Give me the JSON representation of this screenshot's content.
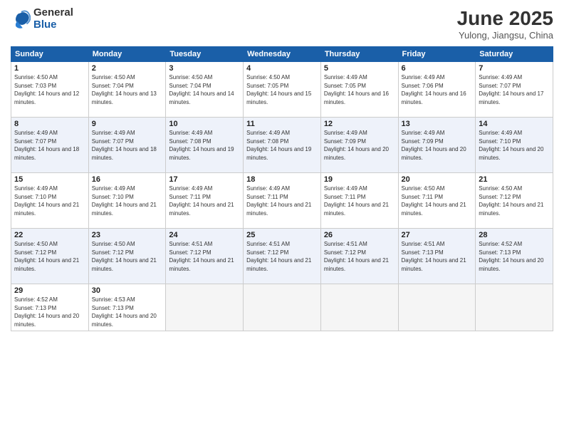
{
  "header": {
    "logo_general": "General",
    "logo_blue": "Blue",
    "title": "June 2025",
    "subtitle": "Yulong, Jiangsu, China"
  },
  "days_of_week": [
    "Sunday",
    "Monday",
    "Tuesday",
    "Wednesday",
    "Thursday",
    "Friday",
    "Saturday"
  ],
  "weeks": [
    [
      {
        "day": "1",
        "sunrise": "4:50 AM",
        "sunset": "7:03 PM",
        "daylight": "14 hours and 12 minutes."
      },
      {
        "day": "2",
        "sunrise": "4:50 AM",
        "sunset": "7:04 PM",
        "daylight": "14 hours and 13 minutes."
      },
      {
        "day": "3",
        "sunrise": "4:50 AM",
        "sunset": "7:04 PM",
        "daylight": "14 hours and 14 minutes."
      },
      {
        "day": "4",
        "sunrise": "4:50 AM",
        "sunset": "7:05 PM",
        "daylight": "14 hours and 15 minutes."
      },
      {
        "day": "5",
        "sunrise": "4:49 AM",
        "sunset": "7:05 PM",
        "daylight": "14 hours and 16 minutes."
      },
      {
        "day": "6",
        "sunrise": "4:49 AM",
        "sunset": "7:06 PM",
        "daylight": "14 hours and 16 minutes."
      },
      {
        "day": "7",
        "sunrise": "4:49 AM",
        "sunset": "7:07 PM",
        "daylight": "14 hours and 17 minutes."
      }
    ],
    [
      {
        "day": "8",
        "sunrise": "4:49 AM",
        "sunset": "7:07 PM",
        "daylight": "14 hours and 18 minutes."
      },
      {
        "day": "9",
        "sunrise": "4:49 AM",
        "sunset": "7:07 PM",
        "daylight": "14 hours and 18 minutes."
      },
      {
        "day": "10",
        "sunrise": "4:49 AM",
        "sunset": "7:08 PM",
        "daylight": "14 hours and 19 minutes."
      },
      {
        "day": "11",
        "sunrise": "4:49 AM",
        "sunset": "7:08 PM",
        "daylight": "14 hours and 19 minutes."
      },
      {
        "day": "12",
        "sunrise": "4:49 AM",
        "sunset": "7:09 PM",
        "daylight": "14 hours and 20 minutes."
      },
      {
        "day": "13",
        "sunrise": "4:49 AM",
        "sunset": "7:09 PM",
        "daylight": "14 hours and 20 minutes."
      },
      {
        "day": "14",
        "sunrise": "4:49 AM",
        "sunset": "7:10 PM",
        "daylight": "14 hours and 20 minutes."
      }
    ],
    [
      {
        "day": "15",
        "sunrise": "4:49 AM",
        "sunset": "7:10 PM",
        "daylight": "14 hours and 21 minutes."
      },
      {
        "day": "16",
        "sunrise": "4:49 AM",
        "sunset": "7:10 PM",
        "daylight": "14 hours and 21 minutes."
      },
      {
        "day": "17",
        "sunrise": "4:49 AM",
        "sunset": "7:11 PM",
        "daylight": "14 hours and 21 minutes."
      },
      {
        "day": "18",
        "sunrise": "4:49 AM",
        "sunset": "7:11 PM",
        "daylight": "14 hours and 21 minutes."
      },
      {
        "day": "19",
        "sunrise": "4:49 AM",
        "sunset": "7:11 PM",
        "daylight": "14 hours and 21 minutes."
      },
      {
        "day": "20",
        "sunrise": "4:50 AM",
        "sunset": "7:11 PM",
        "daylight": "14 hours and 21 minutes."
      },
      {
        "day": "21",
        "sunrise": "4:50 AM",
        "sunset": "7:12 PM",
        "daylight": "14 hours and 21 minutes."
      }
    ],
    [
      {
        "day": "22",
        "sunrise": "4:50 AM",
        "sunset": "7:12 PM",
        "daylight": "14 hours and 21 minutes."
      },
      {
        "day": "23",
        "sunrise": "4:50 AM",
        "sunset": "7:12 PM",
        "daylight": "14 hours and 21 minutes."
      },
      {
        "day": "24",
        "sunrise": "4:51 AM",
        "sunset": "7:12 PM",
        "daylight": "14 hours and 21 minutes."
      },
      {
        "day": "25",
        "sunrise": "4:51 AM",
        "sunset": "7:12 PM",
        "daylight": "14 hours and 21 minutes."
      },
      {
        "day": "26",
        "sunrise": "4:51 AM",
        "sunset": "7:12 PM",
        "daylight": "14 hours and 21 minutes."
      },
      {
        "day": "27",
        "sunrise": "4:51 AM",
        "sunset": "7:13 PM",
        "daylight": "14 hours and 21 minutes."
      },
      {
        "day": "28",
        "sunrise": "4:52 AM",
        "sunset": "7:13 PM",
        "daylight": "14 hours and 20 minutes."
      }
    ],
    [
      {
        "day": "29",
        "sunrise": "4:52 AM",
        "sunset": "7:13 PM",
        "daylight": "14 hours and 20 minutes."
      },
      {
        "day": "30",
        "sunrise": "4:53 AM",
        "sunset": "7:13 PM",
        "daylight": "14 hours and 20 minutes."
      },
      null,
      null,
      null,
      null,
      null
    ]
  ]
}
